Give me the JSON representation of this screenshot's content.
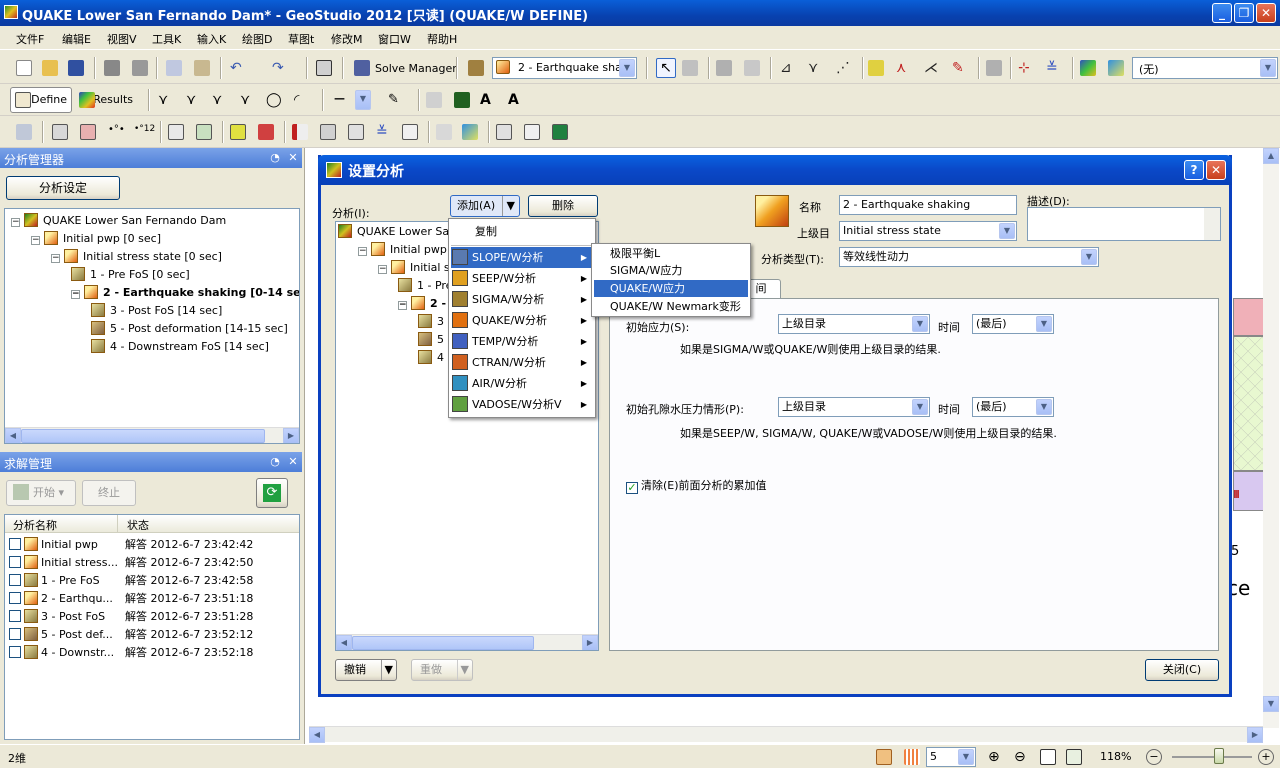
{
  "window": {
    "title": "QUAKE Lower San Fernando Dam* - GeoStudio 2012 [只读] (QUAKE/W DEFINE)"
  },
  "menus": [
    "文件F",
    "编辑E",
    "视图V",
    "工具K",
    "输入K",
    "绘图D",
    "草图t",
    "修改M",
    "窗口W",
    "帮助H"
  ],
  "toolbar": {
    "solve_manager": "Solve Manager",
    "analysis_combo": "2 - Earthquake sha...",
    "none_combo": "(无)",
    "define": "Define",
    "results": "Results"
  },
  "analysis_panel": {
    "title": "分析管理器",
    "setup_button": "分析设定",
    "tree": [
      {
        "label": "QUAKE Lower San Fernando Dam",
        "level": 0,
        "icon": "root"
      },
      {
        "label": "Initial pwp [0 sec]",
        "level": 1,
        "icon": "q"
      },
      {
        "label": "Initial stress state [0 sec]",
        "level": 2,
        "icon": "q"
      },
      {
        "label": "1 - Pre FoS [0 sec]",
        "level": 3,
        "icon": "s"
      },
      {
        "label": "2 - Earthquake shaking [0-14 sec]",
        "level": 3,
        "icon": "q",
        "bold": true
      },
      {
        "label": "3 - Post FoS [14 sec]",
        "level": 4,
        "icon": "s"
      },
      {
        "label": "5 - Post deformation [14-15 sec]",
        "level": 4,
        "icon": "d"
      },
      {
        "label": "4 - Downstream FoS [14 sec]",
        "level": 4,
        "icon": "s"
      }
    ]
  },
  "solve_panel": {
    "title": "求解管理",
    "start": "开始",
    "stop": "终止",
    "col_name": "分析名称",
    "col_status": "状态",
    "rows": [
      {
        "name": "Initial pwp",
        "status": "解答 2012-6-7 23:42:42",
        "icon": "q"
      },
      {
        "name": "Initial stress...",
        "status": "解答 2012-6-7 23:42:50",
        "icon": "q"
      },
      {
        "name": "1 - Pre FoS",
        "status": "解答 2012-6-7 23:42:58",
        "icon": "s"
      },
      {
        "name": "2 - Earthqu...",
        "status": "解答 2012-6-7 23:51:18",
        "icon": "q"
      },
      {
        "name": "3 - Post FoS",
        "status": "解答 2012-6-7 23:51:28",
        "icon": "s"
      },
      {
        "name": "5 - Post def...",
        "status": "解答 2012-6-7 23:52:12",
        "icon": "d"
      },
      {
        "name": "4 - Downstr...",
        "status": "解答 2012-6-7 23:52:18",
        "icon": "s"
      }
    ]
  },
  "dialog": {
    "title": "设置分析",
    "analysis_label": "分析(I):",
    "add_button": "添加(A)",
    "delete_button": "删除",
    "tree": [
      {
        "label": "QUAKE Lower San Fe",
        "icon": "root"
      },
      {
        "label": "Initial pwp [0 sec",
        "icon": "q"
      },
      {
        "label": "Initial stress",
        "icon": "q"
      },
      {
        "label": "1 - Pre F",
        "icon": "s"
      },
      {
        "label": "2 - Eart",
        "icon": "q"
      },
      {
        "label": "3 - I",
        "icon": "s"
      },
      {
        "label": "5 - I",
        "icon": "d"
      },
      {
        "label": "4 - I",
        "icon": "s"
      }
    ],
    "name_label": "名称",
    "name_value": "2 - Earthquake shaking",
    "parent_label": "上级目",
    "parent_value": "Initial stress state",
    "desc_label": "描述(D):",
    "type_label": "分析类型(T):",
    "type_value": "等效线性动力",
    "tab_partial": "间",
    "initial_stress_label": "初始应力(S):",
    "initial_stress_value": "上级目录",
    "time_label": "时间",
    "time_value": "(最后)",
    "initial_stress_note": "如果是SIGMA/W或QUAKE/W则使用上级目录的结果.",
    "pwp_label": "初始孔隙水压力情形(P):",
    "pwp_value": "上级目录",
    "pwp_time_value": "(最后)",
    "pwp_note": "如果是SEEP/W, SIGMA/W, QUAKE/W或VADOSE/W则使用上级目录的结果.",
    "clear_checkbox": "清除(E)前面分析的累加值",
    "undo_button": "撤销",
    "redo_button": "重做",
    "close_button": "关闭(C)"
  },
  "add_menu": {
    "copy": "复制",
    "items": [
      {
        "label": "SLOPE/W分析",
        "color": "#5a7ab0"
      },
      {
        "label": "SEEP/W分析",
        "color": "#e0a020"
      },
      {
        "label": "SIGMA/W分析",
        "color": "#a08030"
      },
      {
        "label": "QUAKE/W分析",
        "color": "#e07010"
      },
      {
        "label": "TEMP/W分析",
        "color": "#4060c0"
      },
      {
        "label": "CTRAN/W分析",
        "color": "#d06020"
      },
      {
        "label": "AIR/W分析",
        "color": "#3090c0"
      },
      {
        "label": "VADOSE/W分析V",
        "color": "#60a040"
      }
    ],
    "submenu": [
      "极限平衡L",
      "SIGMA/W应力",
      "QUAKE/W应力",
      "QUAKE/W Newmark变形"
    ]
  },
  "canvas": {
    "partial_label": "ce",
    "partial_num": "5"
  },
  "statusbar": {
    "mode": "2维",
    "zoom_value": "5",
    "zoom_percent": "118%"
  }
}
